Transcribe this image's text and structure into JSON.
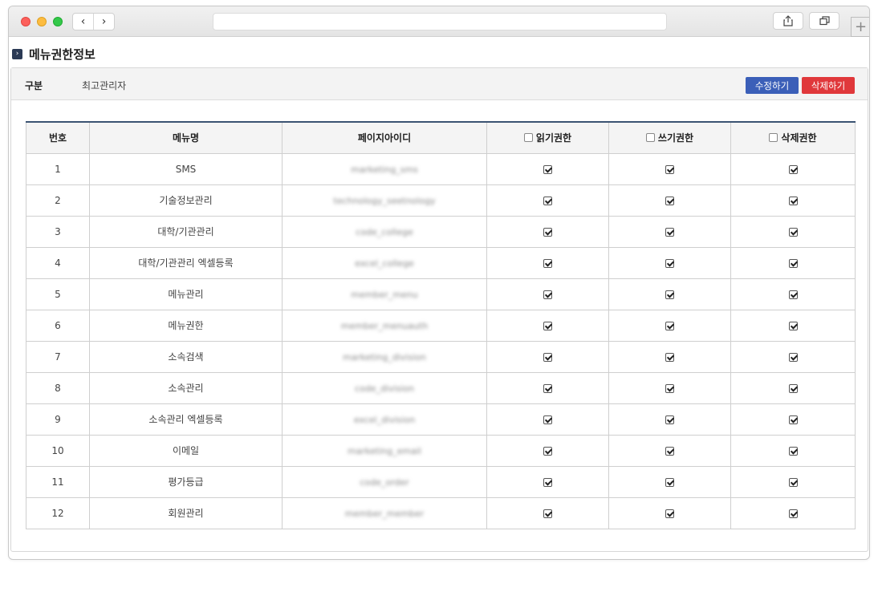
{
  "window": {
    "nav_back": "‹",
    "nav_forward": "›",
    "new_tab": "+"
  },
  "page": {
    "title": "메뉴권한정보",
    "info_label": "구분",
    "info_value": "최고관리자",
    "edit_button": "수정하기",
    "delete_button": "삭제하기",
    "colors": {
      "edit": "#3b5fb8",
      "delete": "#e0383b",
      "header_line": "#3b5372"
    }
  },
  "table": {
    "headers": {
      "no": "번호",
      "menu": "메뉴명",
      "page_id": "페이지아이디",
      "read": "읽기권한",
      "write": "쓰기권한",
      "delete": "삭제권한"
    },
    "rows": [
      {
        "no": "1",
        "menu": "SMS",
        "page_id": "marketing_sms"
      },
      {
        "no": "2",
        "menu": "기술정보관리",
        "page_id": "technology_seetnology"
      },
      {
        "no": "3",
        "menu": "대학/기관관리",
        "page_id": "code_college"
      },
      {
        "no": "4",
        "menu": "대학/기관관리 엑셀등록",
        "page_id": "excel_college"
      },
      {
        "no": "5",
        "menu": "메뉴관리",
        "page_id": "member_menu"
      },
      {
        "no": "6",
        "menu": "메뉴권한",
        "page_id": "member_menuauth"
      },
      {
        "no": "7",
        "menu": "소속검색",
        "page_id": "marketing_division"
      },
      {
        "no": "8",
        "menu": "소속관리",
        "page_id": "code_division"
      },
      {
        "no": "9",
        "menu": "소속관리 엑셀등록",
        "page_id": "excel_division"
      },
      {
        "no": "10",
        "menu": "이메일",
        "page_id": "marketing_email"
      },
      {
        "no": "11",
        "menu": "평가등급",
        "page_id": "code_order"
      },
      {
        "no": "12",
        "menu": "회원관리",
        "page_id": "member_member"
      }
    ]
  }
}
